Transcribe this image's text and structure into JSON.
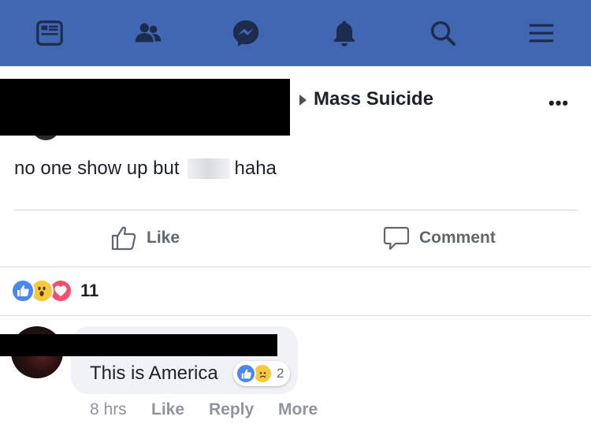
{
  "nav": {
    "items": [
      {
        "icon": "news-feed-icon"
      },
      {
        "icon": "friends-icon"
      },
      {
        "icon": "messenger-icon"
      },
      {
        "icon": "notifications-bell-icon"
      },
      {
        "icon": "search-icon"
      },
      {
        "icon": "menu-icon"
      }
    ],
    "bg_color": "#4267b2"
  },
  "post": {
    "group_name": "Mass Suicide",
    "more_label": "•••",
    "text_before": "no one show up but",
    "text_after": "haha",
    "actions": {
      "like_label": "Like",
      "comment_label": "Comment"
    },
    "reactions": {
      "types": [
        "like",
        "wow",
        "love"
      ],
      "count": "11"
    }
  },
  "comment": {
    "text": "This is America",
    "reactions": {
      "types": [
        "like",
        "sad"
      ],
      "count": "2"
    },
    "time": "8 hrs",
    "like_label": "Like",
    "reply_label": "Reply",
    "more_label": "More"
  },
  "colors": {
    "like_blue": "#4a88ed",
    "wow_yellow": "#f7c83a",
    "love_red": "#f0506e",
    "muted_text": "#90949c"
  }
}
